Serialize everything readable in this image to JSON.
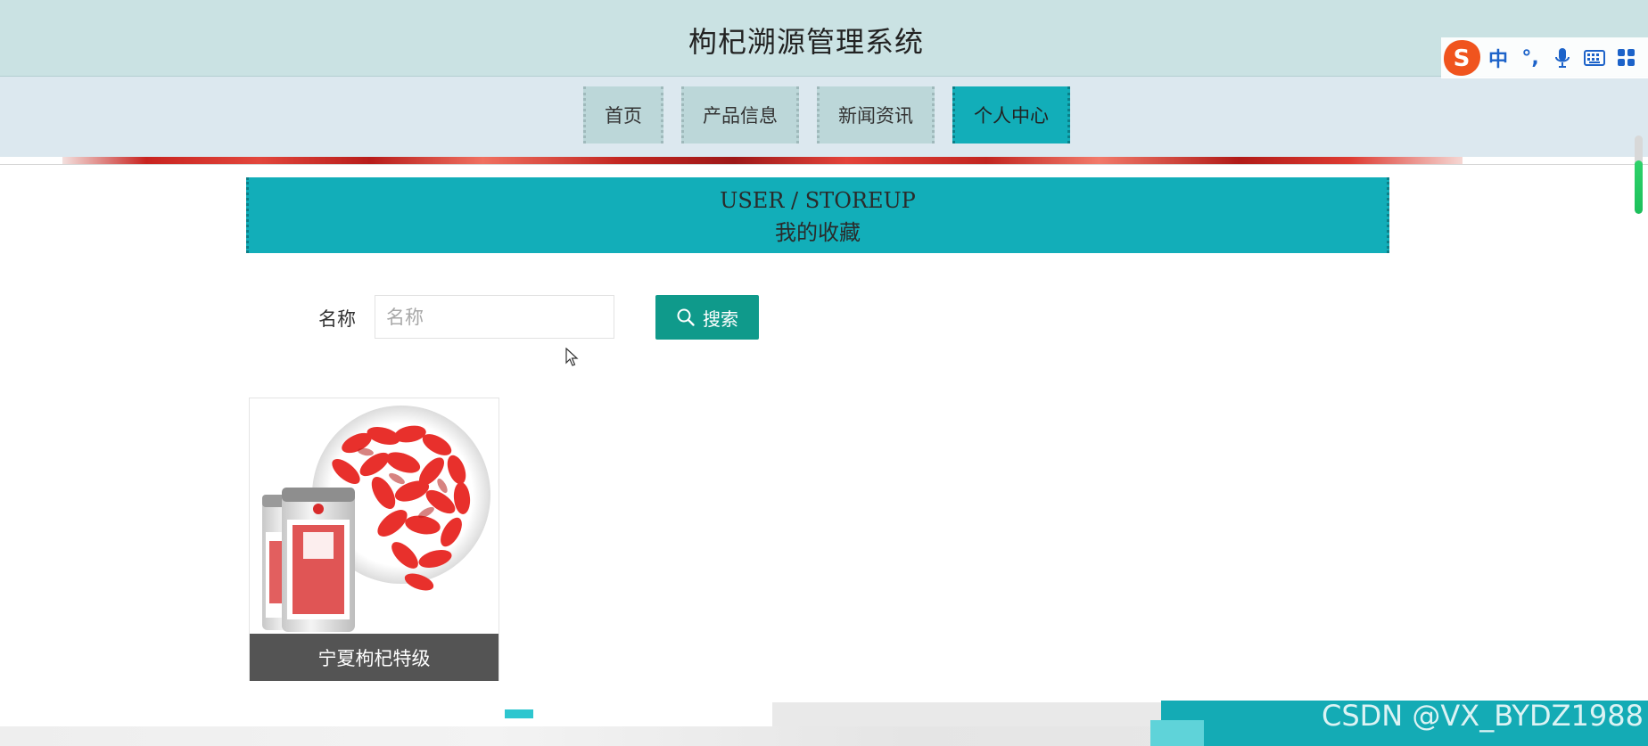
{
  "header": {
    "title": "枸杞溯源管理系统"
  },
  "nav": {
    "items": [
      {
        "label": "首页",
        "active": false
      },
      {
        "label": "产品信息",
        "active": false
      },
      {
        "label": "新闻资讯",
        "active": false
      },
      {
        "label": "个人中心",
        "active": true
      }
    ]
  },
  "section": {
    "title_en": "USER / STOREUP",
    "title_cn": "我的收藏"
  },
  "search": {
    "label": "名称",
    "placeholder": "名称",
    "value": "",
    "button_label": "搜索",
    "button_icon": "search-icon"
  },
  "products": [
    {
      "name": "宁夏枸杞特级"
    }
  ],
  "ime": {
    "logo_letter": "S",
    "mode": "中",
    "punct": "°,"
  },
  "watermark": "CSDN @VX_BYDZ1988",
  "colors": {
    "header_bg": "#cae2e3",
    "nav_bg": "#dce8ef",
    "nav_item_bg": "#bcd7d9",
    "accent_teal": "#12aeb9",
    "search_button_bg": "#0f9a8b",
    "caption_bg": "#545454",
    "ime_logo": "#f0541e",
    "ime_icons": "#1d63c9"
  }
}
